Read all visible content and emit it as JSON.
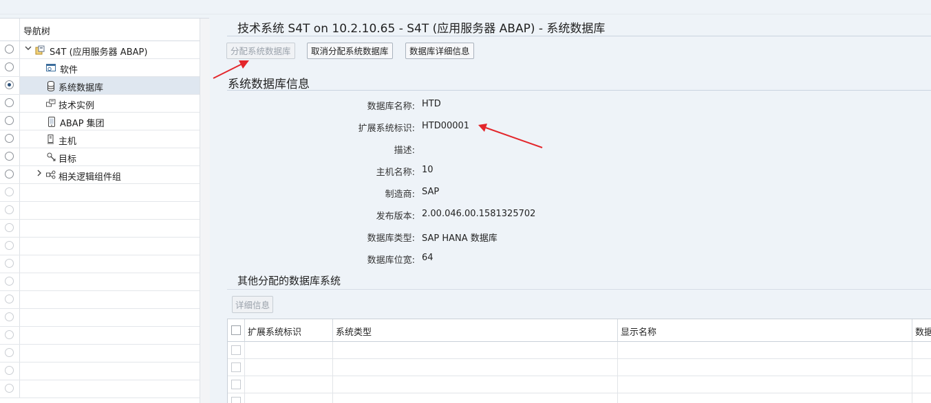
{
  "page_title": "技术系统 S4T on 10.2.10.65 - S4T (应用服务器 ABAP) - 系统数据库",
  "nav": {
    "header": "导航树",
    "items": [
      {
        "label": "S4T (应用服务器 ABAP)",
        "icon": "system-folder-icon",
        "expander": "expanded",
        "selected": false
      },
      {
        "label": "软件",
        "icon": "software-icon",
        "selected": false
      },
      {
        "label": "系统数据库",
        "icon": "database-icon",
        "selected": true
      },
      {
        "label": "技术实例",
        "icon": "technical-instance-icon",
        "selected": false
      },
      {
        "label": "ABAP 集团",
        "icon": "mobile-device-icon",
        "selected": false
      },
      {
        "label": "主机",
        "icon": "host-icon",
        "selected": false
      },
      {
        "label": "目标",
        "icon": "target-icon",
        "selected": false
      },
      {
        "label": "相关逻辑组件组",
        "icon": "logical-component-icon",
        "expander": "collapsed",
        "selected": false
      }
    ]
  },
  "toolbar": {
    "assign_label": "分配系统数据库",
    "unassign_label": "取消分配系统数据库",
    "details_label": "数据库详细信息"
  },
  "db_info": {
    "title": "系统数据库信息",
    "fields": [
      {
        "label": "数据库名称:",
        "value": "HTD"
      },
      {
        "label": "扩展系统标识:",
        "value": "HTD00001"
      },
      {
        "label": "描述:",
        "value": ""
      },
      {
        "label": "主机名称:",
        "value": "10"
      },
      {
        "label": "制造商:",
        "value": "SAP"
      },
      {
        "label": "发布版本:",
        "value": "2.00.046.00.1581325702"
      },
      {
        "label": "数据库类型:",
        "value": "SAP HANA 数据库"
      },
      {
        "label": "数据库位宽:",
        "value": "64"
      }
    ]
  },
  "other_db": {
    "title": "其他分配的数据库系统",
    "details_button": "详细信息",
    "columns": [
      "扩展系统标识",
      "系统类型",
      "显示名称",
      "数据"
    ]
  },
  "colors": {
    "annotation_arrow": "#e3262b",
    "selected_row": "#dfe7f0"
  }
}
